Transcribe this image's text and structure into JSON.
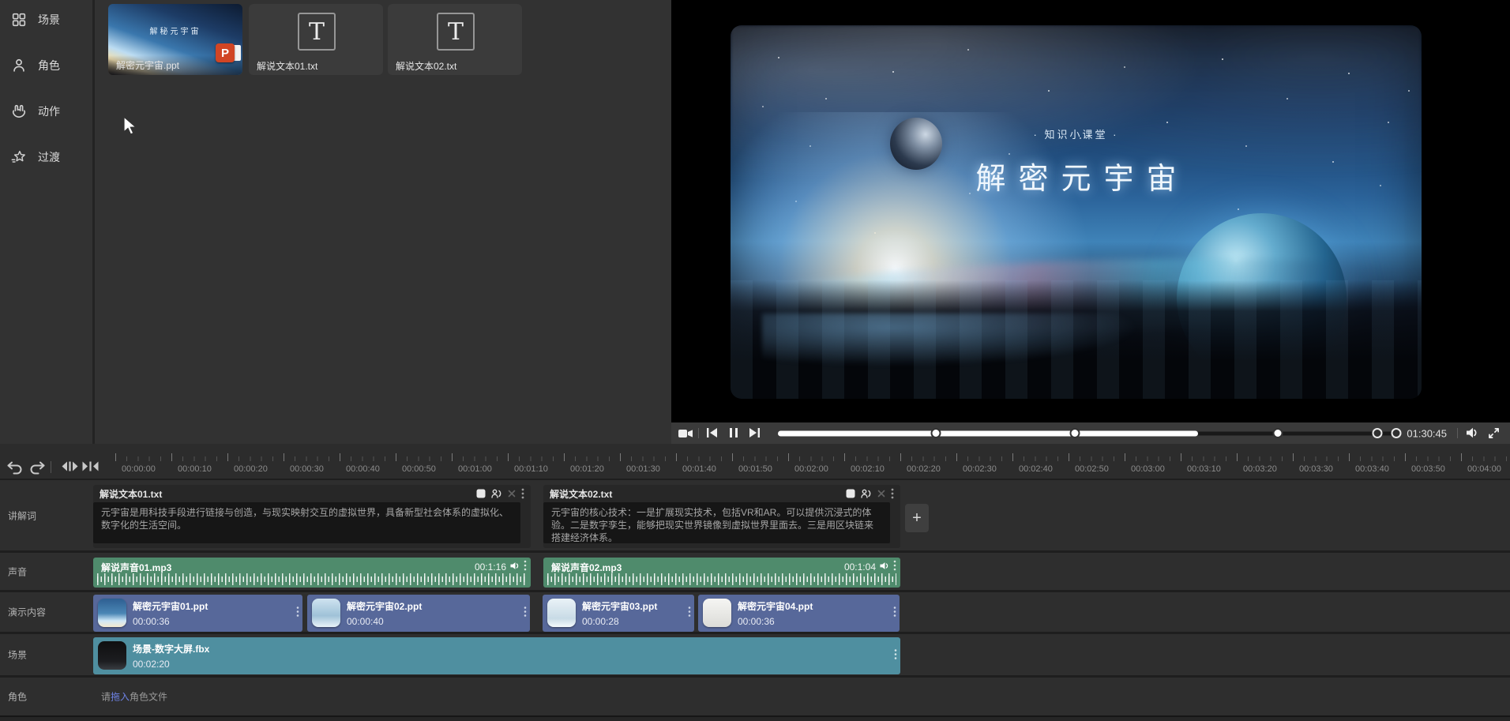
{
  "sidebar": {
    "items": [
      {
        "id": "scene",
        "label": "场景"
      },
      {
        "id": "role",
        "label": "角色"
      },
      {
        "id": "action",
        "label": "动作"
      },
      {
        "id": "transition",
        "label": "过渡"
      }
    ]
  },
  "assets": {
    "items": [
      {
        "name": "解密元宇宙.ppt",
        "type": "ppt",
        "caption": "解秘元宇宙",
        "badge": "P"
      },
      {
        "name": "解说文本01.txt",
        "type": "txt",
        "glyph": "T"
      },
      {
        "name": "解说文本02.txt",
        "type": "txt",
        "glyph": "T"
      }
    ]
  },
  "preview": {
    "tag": "·  知识小课堂  ·",
    "title": "解密元宇宙"
  },
  "player": {
    "time": "01:30:45"
  },
  "timeline": {
    "add_label": "+",
    "ruler": [
      "00:00:00",
      "00:00:10",
      "00:00:20",
      "00:00:30",
      "00:00:40",
      "00:00:50",
      "00:01:00",
      "00:01:10",
      "00:01:20",
      "00:01:30",
      "00:01:40",
      "00:01:50",
      "00:02:00",
      "00:02:10",
      "00:02:20",
      "00:02:30",
      "00:02:40",
      "00:02:50",
      "00:03:00",
      "00:03:10",
      "00:03:20",
      "00:03:30",
      "00:03:40",
      "00:03:50",
      "00:04:00"
    ],
    "tracks": {
      "narration": {
        "label": "讲解词",
        "clips": [
          {
            "name": "解说文本01.txt",
            "text": "元宇宙是用科技手段进行链接与创造，与现实映射交互的虚拟世界，具备新型社会体系的虚拟化、数字化的生活空间。"
          },
          {
            "name": "解说文本02.txt",
            "text": "元宇宙的核心技术：一是扩展现实技术，包括VR和AR。可以提供沉浸式的体验。二是数字孪生，能够把现实世界镜像到虚拟世界里面去。三是用区块链来搭建经济体系。"
          }
        ]
      },
      "audio": {
        "label": "声音",
        "clips": [
          {
            "name": "解说声音01.mp3",
            "duration": "00:1:16"
          },
          {
            "name": "解说声音02.mp3",
            "duration": "00:1:04"
          }
        ]
      },
      "content": {
        "label": "演示内容",
        "clips": [
          {
            "name": "解密元宇宙01.ppt",
            "duration": "00:00:36"
          },
          {
            "name": "解密元宇宙02.ppt",
            "duration": "00:00:40"
          },
          {
            "name": "解密元宇宙03.ppt",
            "duration": "00:00:28"
          },
          {
            "name": "解密元宇宙04.ppt",
            "duration": "00:00:36"
          }
        ]
      },
      "scene": {
        "label": "场景",
        "clips": [
          {
            "name": "场景-数字大屏.fbx",
            "duration": "00:02:20"
          }
        ]
      },
      "role": {
        "label": "角色",
        "empty": {
          "prefix": "请",
          "link": "拖入",
          "suffix": "角色文件"
        }
      }
    }
  },
  "colors": {
    "audio_clip": "#4f8b6c",
    "ppt_clip": "#57689a",
    "scene_clip": "#4f8fa0",
    "link": "#6e83e6"
  }
}
